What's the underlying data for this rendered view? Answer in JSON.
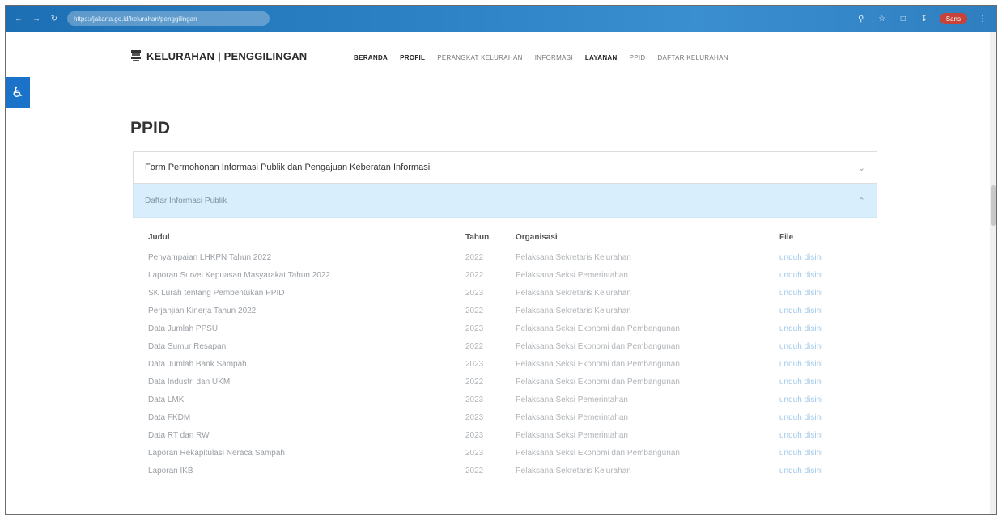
{
  "browser": {
    "url": "https://jakarta.go.id/kelurahan/penggilingan",
    "profile_label": "Sans"
  },
  "site": {
    "logo_text": "KELURAHAN | PENGGILINGAN",
    "menu": [
      "BERANDA",
      "PROFIL",
      "PERANGKAT KELURAHAN",
      "INFORMASI",
      "LAYANAN",
      "PPID",
      "DAFTAR KELURAHAN"
    ]
  },
  "page": {
    "title": "PPID",
    "accordion_1": "Form Permohonan Informasi Publik dan Pengajuan Keberatan Informasi",
    "accordion_2": "Daftar Informasi Publik"
  },
  "table": {
    "headers": [
      "Judul",
      "Tahun",
      "Organisasi",
      "File"
    ],
    "rows": [
      {
        "judul": "Penyampaian LHKPN Tahun 2022",
        "tahun": "2022",
        "organisasi": "Pelaksana Sekretaris Kelurahan",
        "file": "unduh disini"
      },
      {
        "judul": "Laporan Survei Kepuasan Masyarakat Tahun 2022",
        "tahun": "2022",
        "organisasi": "Pelaksana Seksi Pemerintahan",
        "file": "unduh disini"
      },
      {
        "judul": "SK Lurah tentang Pembentukan PPID",
        "tahun": "2023",
        "organisasi": "Pelaksana Sekretaris Kelurahan",
        "file": "unduh disini"
      },
      {
        "judul": "Perjanjian Kinerja Tahun 2022",
        "tahun": "2022",
        "organisasi": "Pelaksana Sekretaris Kelurahan",
        "file": "unduh disini"
      },
      {
        "judul": "Data Jumlah PPSU",
        "tahun": "2023",
        "organisasi": "Pelaksana Seksi Ekonomi dan Pembangunan",
        "file": "unduh disini"
      },
      {
        "judul": "Data Sumur Resapan",
        "tahun": "2022",
        "organisasi": "Pelaksana Seksi Ekonomi dan Pembangunan",
        "file": "unduh disini"
      },
      {
        "judul": "Data Jumlah Bank Sampah",
        "tahun": "2023",
        "organisasi": "Pelaksana Seksi Ekonomi dan Pembangunan",
        "file": "unduh disini"
      },
      {
        "judul": "Data Industri dan UKM",
        "tahun": "2022",
        "organisasi": "Pelaksana Seksi Ekonomi dan Pembangunan",
        "file": "unduh disini"
      },
      {
        "judul": "Data LMK",
        "tahun": "2023",
        "organisasi": "Pelaksana Seksi Pemerintahan",
        "file": "unduh disini"
      },
      {
        "judul": "Data FKDM",
        "tahun": "2023",
        "organisasi": "Pelaksana Seksi Pemerintahan",
        "file": "unduh disini"
      },
      {
        "judul": "Data RT dan RW",
        "tahun": "2023",
        "organisasi": "Pelaksana Seksi Pemerintahan",
        "file": "unduh disini"
      },
      {
        "judul": "Laporan Rekapitulasi Neraca Sampah",
        "tahun": "2023",
        "organisasi": "Pelaksana Seksi Ekonomi dan Pembangunan",
        "file": "unduh disini"
      },
      {
        "judul": "Laporan IKB",
        "tahun": "2022",
        "organisasi": "Pelaksana Sekretaris Kelurahan",
        "file": "unduh disini"
      }
    ]
  }
}
